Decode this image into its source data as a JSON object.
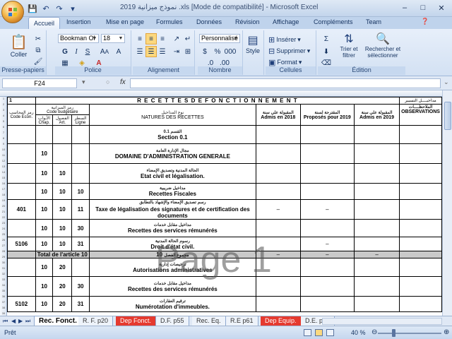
{
  "window": {
    "title": "2019 نموذج ميزانية .xls  [Mode de compatibilité] - Microsoft Excel",
    "controls": [
      "–",
      "□",
      "✕"
    ]
  },
  "qat": {
    "save": "💾",
    "undo": "↶",
    "redo": "↷",
    "more": "▾"
  },
  "tabs": [
    "Accueil",
    "Insertion",
    "Mise en page",
    "Formules",
    "Données",
    "Révision",
    "Affichage",
    "Compléments",
    "Team"
  ],
  "ribbon": {
    "clipboard": {
      "paste": "Coller",
      "label": "Presse-papiers"
    },
    "font": {
      "name": "Bookman Ol",
      "size": "18",
      "label": "Police"
    },
    "alignment": {
      "label": "Alignement"
    },
    "number": {
      "format": "Personnalisé",
      "label": "Nombre"
    },
    "styles": {
      "style": "Style"
    },
    "cells": {
      "insert": "Insérer",
      "delete": "Supprimer",
      "format": "Format",
      "label": "Cellules"
    },
    "editing": {
      "sort": "Trier et filtrer",
      "find": "Rechercher et sélectionner",
      "label": "Édition"
    }
  },
  "formula_bar": {
    "name_box": "F24",
    "fx": "fx",
    "content": ""
  },
  "sheet": {
    "header_title": "R E C E T T E S   D E  F O N C T I O N N E M E N T",
    "header_right": "مداخيــــل التسيير",
    "row1_num": "1",
    "col_heads": {
      "code_econ_ar": "رمز المحاسب",
      "code_econ": "Code Econ.",
      "code_budget_ar": "رمز الميزانية",
      "code_budget": "Code budgétaire",
      "chap_ar": "الأبواب",
      "chap": "Chap.",
      "art_ar": "الفصول",
      "art": "Art.",
      "ligne_ar": "السطر",
      "ligne": "Ligne",
      "natures_ar": "نوع المداخيل",
      "natures": "NATURES DES RECETTES",
      "admis2018_ar": "المقبولة على سنة",
      "admis2018": "Admis en 2018",
      "proposes_ar": "المقترحة لسنة",
      "proposes": "Proposés pour 2019",
      "admis2019_ar": "المقبولة على سنة",
      "admis2019": "Admis en 2019",
      "obs_ar": "الملاحظــــات",
      "obs": "OBSERVATIONS"
    },
    "rows": [
      {
        "econ": "",
        "chap": "",
        "art": "",
        "ligne": "",
        "ar": "القسم 0.1",
        "fr": "Section 0.1",
        "a": "",
        "b": "",
        "c": ""
      },
      {
        "econ": "",
        "chap": "10",
        "art": "",
        "ligne": "",
        "ar": "مجال الإدارة العامة",
        "fr": "DOMAINE D'ADMINISTRATION GENERALE",
        "a": "",
        "b": "",
        "c": ""
      },
      {
        "econ": "",
        "chap": "10",
        "art": "10",
        "ligne": "",
        "ar": "الحالة المدنية وتصديق الإمضاء",
        "fr": "Etat civil et légalisation.",
        "a": "",
        "b": "",
        "c": ""
      },
      {
        "econ": "",
        "chap": "10",
        "art": "10",
        "ligne": "10",
        "ar": "مداخيل ضريبية",
        "fr": "Recettes Fiscales",
        "a": "",
        "b": "",
        "c": ""
      },
      {
        "econ": "401",
        "chap": "10",
        "art": "10",
        "ligne": "11",
        "ar": "رسم تصديق الإمضاء والإشهاد بالتطابق",
        "fr": "Taxe de légalisation des signatures et de certification des documents",
        "a": "–",
        "b": "–",
        "c": ""
      },
      {
        "econ": "",
        "chap": "10",
        "art": "10",
        "ligne": "30",
        "ar": "مداخيل مقابل خدمات",
        "fr": "Recettes des services rémunérés",
        "a": "",
        "b": "",
        "c": ""
      },
      {
        "econ": "5106",
        "chap": "10",
        "art": "10",
        "ligne": "31",
        "ar": "رسوم الحالة المدنية",
        "fr": "Droit d'état civil.",
        "a": "",
        "b": "–",
        "c": ""
      },
      {
        "econ": "",
        "chap": "",
        "art": "",
        "ligne": "",
        "ar": "",
        "fr": "",
        "a": "",
        "b": "",
        "c": ""
      },
      {
        "econ": "",
        "chap": "10",
        "art": "20",
        "ligne": "",
        "ar": "ترخيصات إدارية",
        "fr": "Autorisations administratives",
        "a": "",
        "b": "",
        "c": ""
      },
      {
        "econ": "",
        "chap": "10",
        "art": "20",
        "ligne": "30",
        "ar": "مداخيل مقابل خدمات",
        "fr": "Recettes des services rémunérés",
        "a": "",
        "b": "",
        "c": ""
      },
      {
        "econ": "5102",
        "chap": "10",
        "art": "20",
        "ligne": "31",
        "ar": "ترقيم العقارات",
        "fr": "Numérotation d'immeubles.",
        "a": "",
        "b": "",
        "c": ""
      }
    ],
    "total_row": {
      "label": "Total de l'article  10",
      "num": "10",
      "ar": "مجموع الفصل",
      "a": "–",
      "b": "–",
      "c": "–"
    },
    "watermark": "Page 1"
  },
  "sheet_tabs": [
    "Rec. Fonct.",
    "R. F. p20",
    "Dep Fonct.",
    "D.F. p55",
    "Rec. Eq.",
    "R.E p61",
    "Dep Equip.",
    "D.E. p10"
  ],
  "status": {
    "text": "Prêt",
    "zoom": "40 %"
  }
}
